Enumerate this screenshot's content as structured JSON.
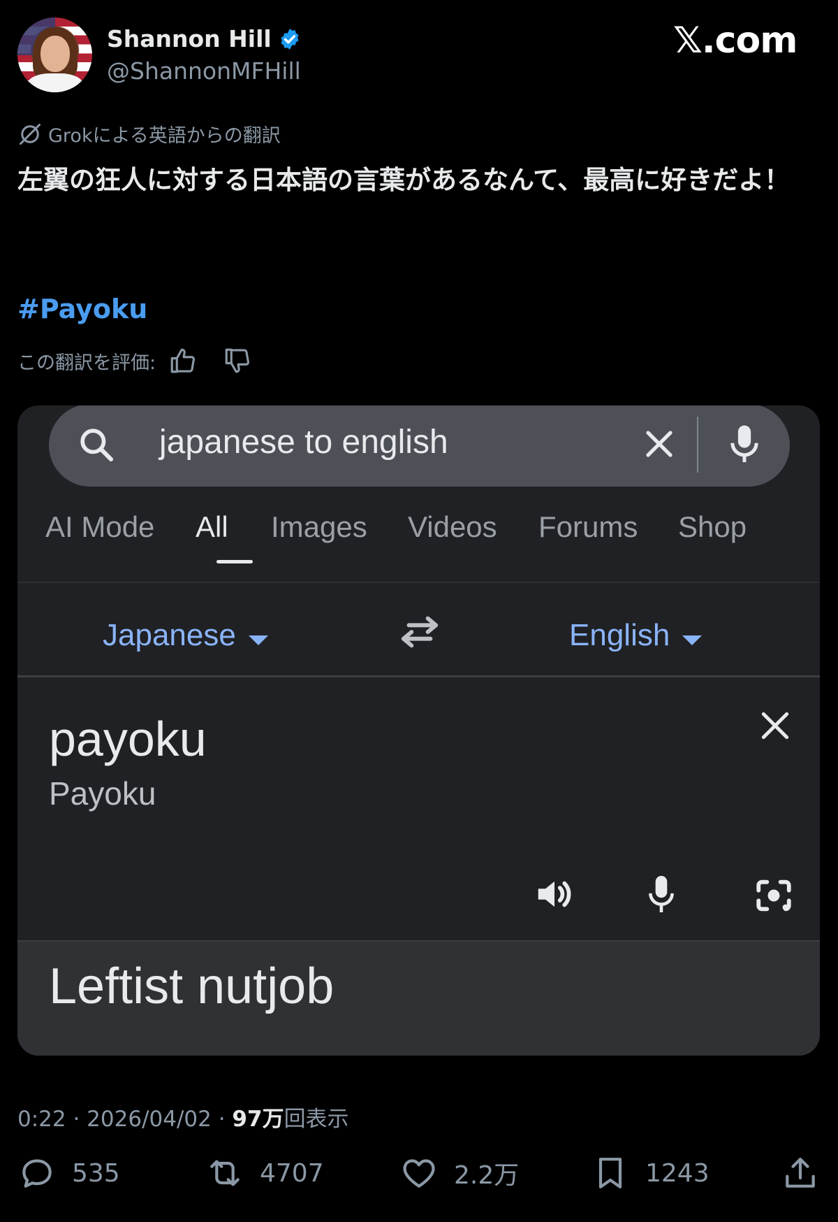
{
  "tweet": {
    "display_name": "Shannon Hill",
    "handle": "@ShannonMFHill",
    "site": "𝕏.com",
    "translation_note": "Grokによる英語からの翻訳",
    "text": "左翼の狂人に対する日本語の言葉があるなんて、最高に好きだよ！",
    "hashtag": "#Payoku",
    "rate_label": "この翻訳を評価:",
    "meta": {
      "time": "0:22 · 2026/04/02 · ",
      "views_number": "97",
      "views_unit": "万",
      "views_label": "回表示"
    },
    "actions": {
      "replies": "535",
      "reposts": "4707",
      "likes": "2.2万",
      "bookmarks": "1243"
    }
  },
  "embedded_screenshot": {
    "search": {
      "query": "japanese to english"
    },
    "tabs": [
      "AI Mode",
      "All",
      "Images",
      "Videos",
      "Forums",
      "Shop"
    ],
    "active_tab": "All",
    "source_language": "Japanese",
    "target_language": "English",
    "input_text": "payoku",
    "romanization": "Payoku",
    "translation": "Leftist nutjob"
  },
  "colors": {
    "background": "#000000",
    "link": "#4a9cf0",
    "verified": "#1d9bf0",
    "google_link": "#8ab4f8",
    "card_bg": "#202124"
  }
}
